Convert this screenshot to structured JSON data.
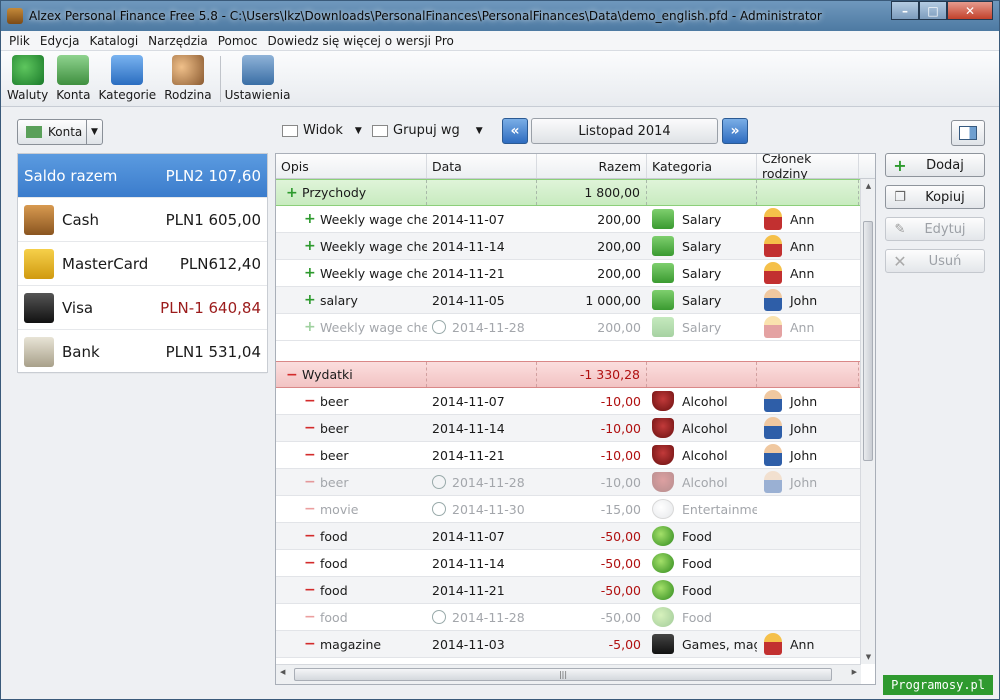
{
  "window": {
    "title": "Alzex Personal Finance Free 5.8 - C:\\Users\\lkz\\Downloads\\PersonalFinances\\PersonalFinances\\Data\\demo_english.pfd - Administrator"
  },
  "menu": [
    "Plik",
    "Edycja",
    "Katalogi",
    "Narzędzia",
    "Pomoc",
    "Dowiedz się więcej o wersji Pro"
  ],
  "toolbar": {
    "waluty": "Waluty",
    "konta": "Konta",
    "kategorie": "Kategorie",
    "rodzina": "Rodzina",
    "ustawienia": "Ustawienia"
  },
  "subbar": {
    "konta": "Konta",
    "widok": "Widok",
    "grupuj": "Grupuj wg",
    "month": "Listopad 2014"
  },
  "accounts": {
    "total_label": "Saldo razem",
    "total_balance": "PLN2 107,60",
    "items": [
      {
        "name": "Cash",
        "balance": "PLN1 605,00"
      },
      {
        "name": "MasterCard",
        "balance": "PLN612,40"
      },
      {
        "name": "Visa",
        "balance": "PLN-1 640,84"
      },
      {
        "name": "Bank",
        "balance": "PLN1 531,04"
      }
    ]
  },
  "grid": {
    "columns": [
      "Opis",
      "Data",
      "Razem",
      "Kategoria",
      "Członek rodziny"
    ],
    "income_group": {
      "label": "Przychody",
      "total": "1 800,00"
    },
    "income": [
      {
        "desc": "Weekly wage chec",
        "date": "2014-11-07",
        "amount": "200,00",
        "category": "Salary",
        "member": "Ann"
      },
      {
        "desc": "Weekly wage chec",
        "date": "2014-11-14",
        "amount": "200,00",
        "category": "Salary",
        "member": "Ann"
      },
      {
        "desc": "Weekly wage chec",
        "date": "2014-11-21",
        "amount": "200,00",
        "category": "Salary",
        "member": "Ann"
      },
      {
        "desc": "salary",
        "date": "2014-11-05",
        "amount": "1 000,00",
        "category": "Salary",
        "member": "John"
      },
      {
        "desc": "Weekly wage chec",
        "date": "2014-11-28",
        "amount": "200,00",
        "category": "Salary",
        "member": "Ann"
      }
    ],
    "expense_group": {
      "label": "Wydatki",
      "total": "-1 330,28"
    },
    "expenses": [
      {
        "desc": "beer",
        "date": "2014-11-07",
        "amount": "-10,00",
        "category": "Alcohol",
        "member": "John"
      },
      {
        "desc": "beer",
        "date": "2014-11-14",
        "amount": "-10,00",
        "category": "Alcohol",
        "member": "John"
      },
      {
        "desc": "beer",
        "date": "2014-11-21",
        "amount": "-10,00",
        "category": "Alcohol",
        "member": "John"
      },
      {
        "desc": "beer",
        "date": "2014-11-28",
        "amount": "-10,00",
        "category": "Alcohol",
        "member": "John"
      },
      {
        "desc": "movie",
        "date": "2014-11-30",
        "amount": "-15,00",
        "category": "Entertainmen",
        "member": ""
      },
      {
        "desc": "food",
        "date": "2014-11-07",
        "amount": "-50,00",
        "category": "Food",
        "member": ""
      },
      {
        "desc": "food",
        "date": "2014-11-14",
        "amount": "-50,00",
        "category": "Food",
        "member": ""
      },
      {
        "desc": "food",
        "date": "2014-11-21",
        "amount": "-50,00",
        "category": "Food",
        "member": ""
      },
      {
        "desc": "food",
        "date": "2014-11-28",
        "amount": "-50,00",
        "category": "Food",
        "member": ""
      },
      {
        "desc": "magazine",
        "date": "2014-11-03",
        "amount": "-5,00",
        "category": "Games, maga",
        "member": "Ann"
      }
    ]
  },
  "actions": {
    "add": "Dodaj",
    "copy": "Kopiuj",
    "edit": "Edytuj",
    "delete": "Usuń"
  },
  "watermark": "Programosy.pl",
  "colors": {
    "income": "#2d9a2d",
    "expense": "#d32b2b",
    "selection": "#4a8bd8"
  }
}
